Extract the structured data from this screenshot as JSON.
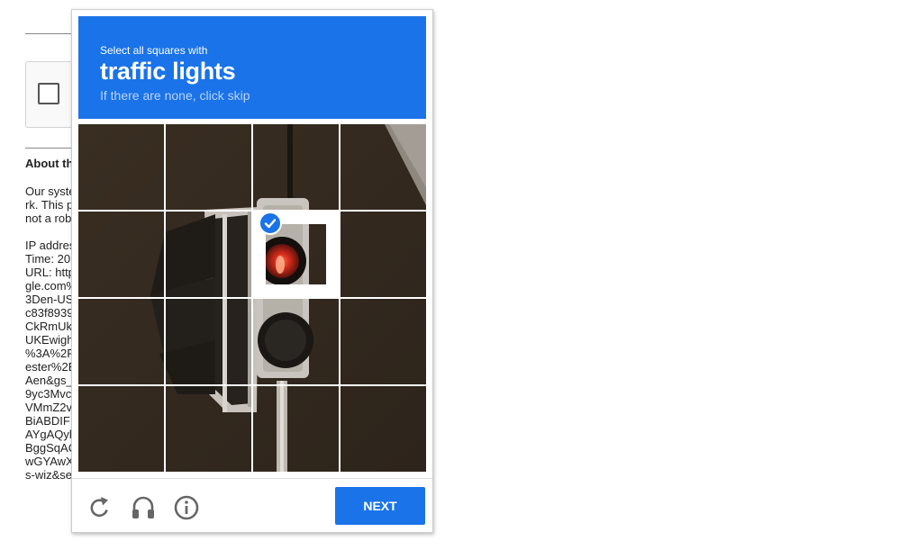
{
  "background": {
    "heading": "About th",
    "paragraph": [
      "Our syste",
      "rk. This p",
      "not a rob"
    ],
    "details": [
      "IP addres",
      "Time: 20",
      "URL: http",
      "gle.com%",
      "3Den-US",
      "c83f8939",
      "CkRmUk",
      "UKEwigh",
      "%3A%2F",
      "ester%2E",
      "Aen&gs_",
      "9yc3Mvc",
      "VMmZ2v",
      "BiABDIF",
      "AYgAQyl",
      "BggSqAC",
      "wGYAwX",
      "s-wiz&se"
    ]
  },
  "challenge": {
    "instruction": "Select all squares with",
    "target": "traffic lights",
    "hint": "If there are none, click skip",
    "tiles": [
      {
        "selected": false
      },
      {
        "selected": false
      },
      {
        "selected": false
      },
      {
        "selected": false
      },
      {
        "selected": false
      },
      {
        "selected": false
      },
      {
        "selected": true
      },
      {
        "selected": false
      },
      {
        "selected": false
      },
      {
        "selected": false
      },
      {
        "selected": false
      },
      {
        "selected": false
      },
      {
        "selected": false
      },
      {
        "selected": false
      },
      {
        "selected": false
      },
      {
        "selected": false
      }
    ],
    "next_label": "NEXT",
    "icons": [
      "reload-icon",
      "headphones-icon",
      "info-icon"
    ],
    "colors": {
      "accent": "#1a73e8",
      "icon": "#666666"
    }
  }
}
